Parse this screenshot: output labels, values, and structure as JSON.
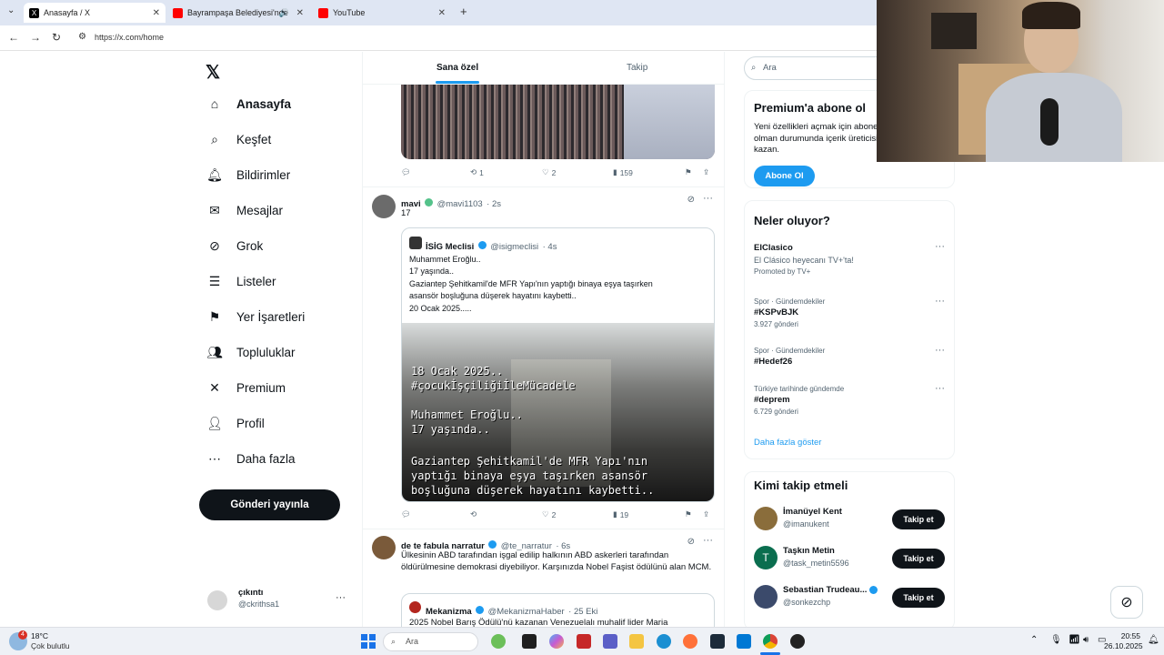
{
  "browser": {
    "tabs": [
      {
        "title": "Anasayfa / X"
      },
      {
        "title": "Bayrampaşa Belediyesi'nde"
      },
      {
        "title": "YouTube"
      }
    ],
    "url": "https://x.com/home"
  },
  "sidebar": {
    "items": [
      {
        "label": "Anasayfa",
        "icon": "home-icon"
      },
      {
        "label": "Keşfet",
        "icon": "search-icon"
      },
      {
        "label": "Bildirimler",
        "icon": "bell-icon"
      },
      {
        "label": "Mesajlar",
        "icon": "mail-icon"
      },
      {
        "label": "Grok",
        "icon": "grok-icon"
      },
      {
        "label": "Listeler",
        "icon": "list-icon"
      },
      {
        "label": "Yer İşaretleri",
        "icon": "bookmark-icon"
      },
      {
        "label": "Topluluklar",
        "icon": "people-icon"
      },
      {
        "label": "Premium",
        "icon": "x-icon"
      },
      {
        "label": "Profil",
        "icon": "person-icon"
      },
      {
        "label": "Daha fazla",
        "icon": "more-circle-icon"
      }
    ],
    "post_button": "Gönderi yayınla",
    "account": {
      "name": "çıkıntı",
      "handle": "@ckrithsa1"
    }
  },
  "feed": {
    "tabs": [
      "Sana özel",
      "Takip"
    ],
    "post0": {
      "retweets": "1",
      "likes": "2",
      "views": "159"
    },
    "post1": {
      "name": "mavi",
      "handle": "@mavi1103",
      "time": "· 2s",
      "text": "17",
      "quote": {
        "name": "İSİG Meclisi",
        "handle": "@isigmeclisi",
        "time": "· 4s",
        "lines": [
          "Muhammet Eroğlu..",
          "17 yaşında..",
          "Gaziantep Şehitkamil'de MFR Yapı'nın yaptığı binaya eşya taşırken",
          "asansör boşluğuna düşerek hayatını kaybetti..",
          "20 Ocak 2025....."
        ],
        "overlay": [
          "18 Ocak 2025..",
          "#çocukİşçiliğiİleMücadele",
          "Muhammet Eroğlu..",
          "17 yaşında..",
          "Gaziantep Şehitkamil'de MFR Yapı'nın",
          "yaptığı binaya eşya taşırken asansör",
          "boşluğuna düşerek hayatını kaybetti.."
        ]
      },
      "likes": "2",
      "views": "19"
    },
    "post2": {
      "name": "de te fabula narratur",
      "handle": "@te_narratur",
      "time": "· 6s",
      "text": "Ülkesinin ABD tarafından işgal edilip halkının ABD askerleri tarafından öldürülmesine demokrasi diyebiliyor. Karşınızda Nobel Faşist ödülünü alan MCM.",
      "quote_name": "Mekanizma",
      "quote_handle": "@MekanizmaHaber",
      "quote_time": "· 25 Eki",
      "quote_text": "2025 Nobel Barış Ödülü'nü kazanan Venezuelalı muhalif lider Maria"
    }
  },
  "right": {
    "search_placeholder": "Ara",
    "premium": {
      "title": "Premium'a abone ol",
      "text": "Yeni özellikleri açmak için abone olman durumunda içerik üreticisi kazan.",
      "button": "Abone Ol"
    },
    "trends_title": "Neler oluyor?",
    "trends": [
      {
        "meta": "",
        "name": "ElClasico",
        "sub": "El Clásico heyecanı TV+'ta!",
        "sub2": "Promoted by TV+"
      },
      {
        "meta": "Spor · Gündemdekiler",
        "name": "#KSPvBJK",
        "sub": "3.927 gönderi"
      },
      {
        "meta": "Spor · Gündemdekiler",
        "name": "#Hedef26",
        "sub": ""
      },
      {
        "meta": "Türkiye tarihinde gündemde",
        "name": "#deprem",
        "sub": "6.729 gönderi"
      }
    ],
    "show_more": "Daha fazla göster",
    "who_title": "Kimi takip etmeli",
    "who": [
      {
        "name": "İmanüyel Kent",
        "handle": "@imanukent",
        "button": "Takip et",
        "color": "#8a6d3b"
      },
      {
        "name": "Taşkın Metin",
        "handle": "@task_metin5596",
        "button": "Takip et",
        "color": "#0b6e4f"
      },
      {
        "name": "Sebastian Trudeau...",
        "handle": "@sonkezchp",
        "button": "Takip et",
        "color": "#3b4a6b"
      }
    ]
  },
  "taskbar": {
    "weather_temp": "18°C",
    "weather_text": "Çok bulutlu",
    "weather_badge": "4",
    "search": "Ara",
    "time": "20:55",
    "date": "26.10.2025"
  }
}
